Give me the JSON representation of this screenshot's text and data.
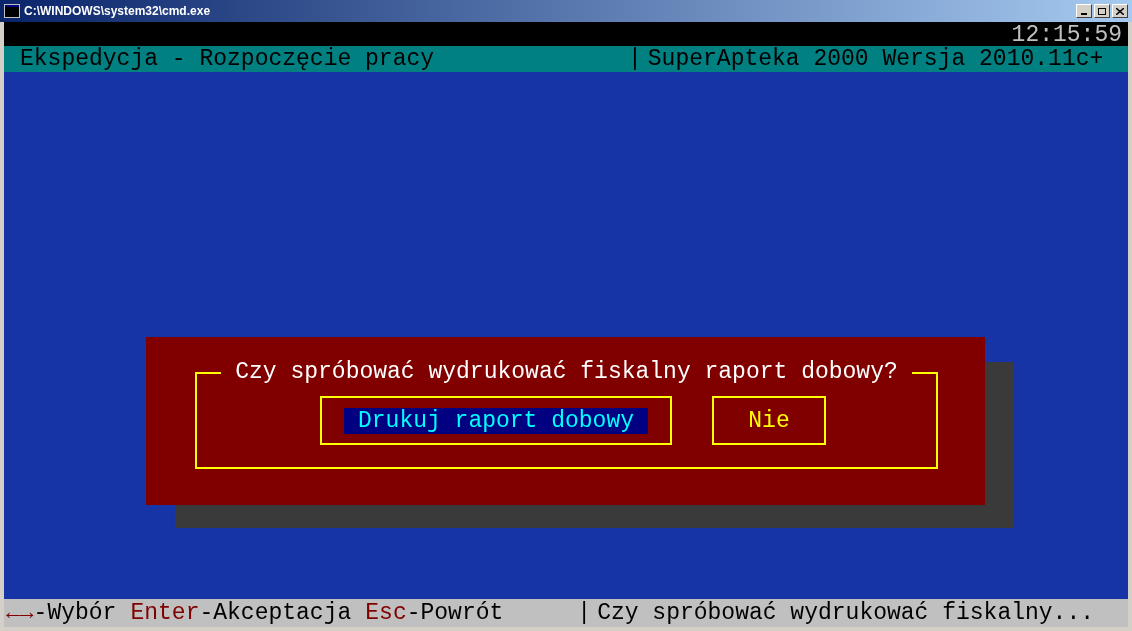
{
  "window": {
    "title": "C:\\WINDOWS\\system32\\cmd.exe"
  },
  "clock": "12:15:59",
  "header": {
    "left": "Ekspedycja - Rozpoczęcie pracy",
    "separator": "|",
    "right": "SuperApteka 2000 Wersja 2010.11c+"
  },
  "dialog": {
    "question": "Czy spróbować wydrukować fiskalny raport dobowy?",
    "buttons": [
      {
        "label": "Drukuj raport dobowy",
        "selected": true
      },
      {
        "label": "Nie",
        "selected": false
      }
    ]
  },
  "status_bar": {
    "hints": [
      {
        "key": "←→",
        "label": "-Wybór"
      },
      {
        "key": "Enter",
        "label": "-Akceptacja"
      },
      {
        "key": "Esc",
        "label": "-Powrót"
      }
    ],
    "separator": "|",
    "message": "Czy spróbować wydrukować fiskalny..."
  }
}
